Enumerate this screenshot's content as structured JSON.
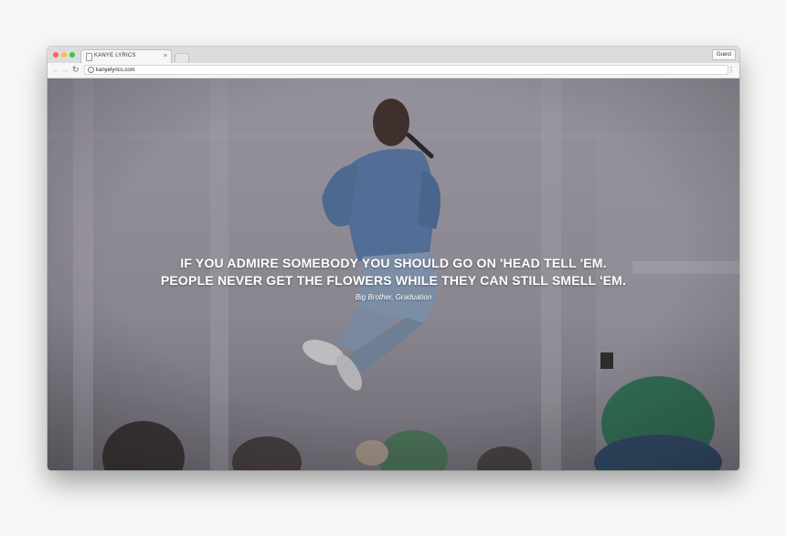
{
  "browser": {
    "tab_title": "KANYE LYRICS",
    "tab_close": "×",
    "guest_label": "Guest",
    "url": "kanyelyrics.com",
    "icons": {
      "back": "back-arrow-icon",
      "forward": "forward-arrow-icon",
      "reload": "reload-icon",
      "info": "info-icon",
      "menu": "kebab-menu-icon"
    }
  },
  "page": {
    "quote_line_1": "IF YOU ADMIRE SOMEBODY YOU SHOULD GO ON 'HEAD TELL 'EM.",
    "quote_line_2": "PEOPLE NEVER GET THE FLOWERS WHILE THEY CAN STILL SMELL 'EM.",
    "attribution": "Big Brother, Graduation"
  },
  "colors": {
    "page_background": "#f7f7f7",
    "photo_tint": "#8e8b93",
    "quote_text": "#ffffff"
  }
}
